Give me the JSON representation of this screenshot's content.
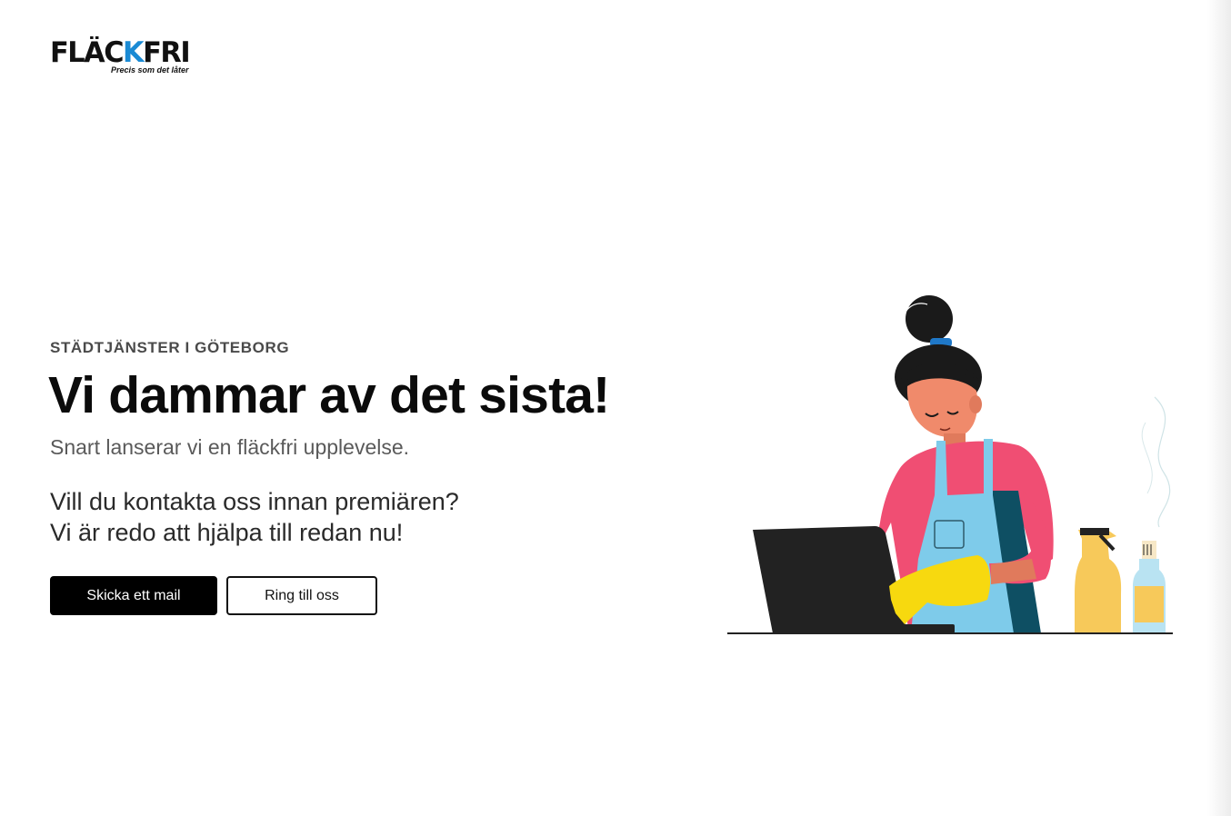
{
  "logo": {
    "wordmark_part1": "FLÄC",
    "wordmark_k": "K",
    "wordmark_part2": "FRI",
    "tagline": "Precis som det låter",
    "accent_color": "#1a8ad4"
  },
  "hero": {
    "eyebrow": "STÄDTJÄNSTER I GÖTEBORG",
    "headline": "Vi dammar av det sista!",
    "subheadline": "Snart lanserar vi en fläckfri upplevelse.",
    "contact_line1": "Vill du kontakta oss innan premiären?",
    "contact_line2": "Vi är redo att hjälpa till redan nu!"
  },
  "buttons": {
    "mail_label": "Skicka ett mail",
    "call_label": "Ring till oss"
  },
  "illustration": {
    "subject": "woman-cleaning-laptop-illustration",
    "colors": {
      "shirt": "#f04e73",
      "apron": "#7ecbea",
      "glove": "#f7d90f",
      "laptop": "#222222",
      "hair": "#1a1a1a",
      "skin": "#f08a6b",
      "spray_bottle": "#f7c95a",
      "glass_bottle": "#b9e3f2"
    }
  }
}
